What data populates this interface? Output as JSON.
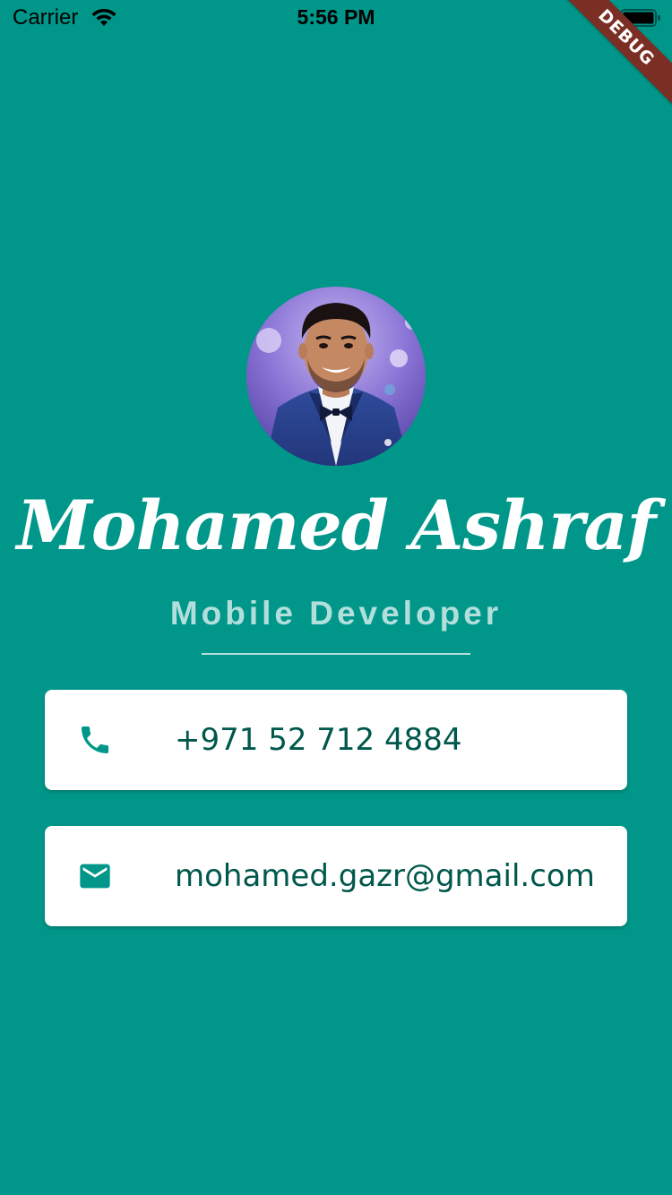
{
  "status_bar": {
    "carrier": "Carrier",
    "time": "5:56 PM",
    "wifi_icon": "wifi-icon",
    "battery_icon": "battery-icon"
  },
  "debug_banner": "DEBUG",
  "profile": {
    "name": "Mohamed Ashraf",
    "role": "Mobile Developer",
    "avatar_icon": "avatar-photo"
  },
  "contacts": {
    "phone": {
      "icon": "phone-icon",
      "value": "+971 52 712 4884"
    },
    "email": {
      "icon": "mail-icon",
      "value": "mohamed.gazr@gmail.com"
    }
  },
  "colors": {
    "background": "#00978A",
    "card_text": "#00574B",
    "role_text": "#B2DFDB",
    "debug_ribbon": "#7B2E24"
  }
}
